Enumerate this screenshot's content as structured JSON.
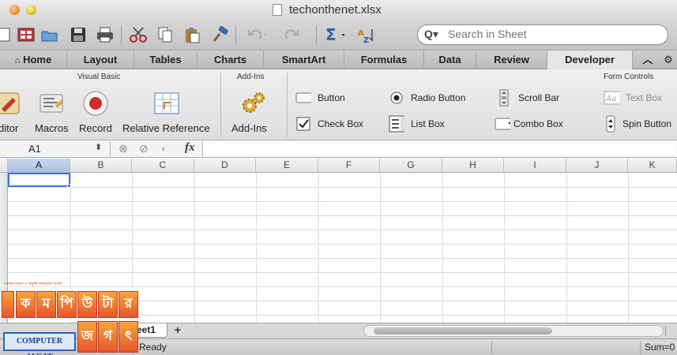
{
  "window": {
    "title": "techonthenet.xlsx"
  },
  "toolbar": {
    "buttons": [
      "new-document",
      "gallery",
      "open",
      "save",
      "print",
      "cut",
      "copy",
      "paste",
      "format-painter",
      "undo",
      "redo",
      "autosum",
      "sort-filter"
    ],
    "search_placeholder": "Search in Sheet"
  },
  "ribbon_tabs": [
    "Home",
    "Layout",
    "Tables",
    "Charts",
    "SmartArt",
    "Formulas",
    "Data",
    "Review",
    "Developer"
  ],
  "active_tab": "Developer",
  "ribbon": {
    "groups": {
      "visual_basic": "Visual Basic",
      "add_ins": "Add-Ins",
      "form_controls": "Form Controls"
    },
    "big_buttons": {
      "editor": "ditor",
      "macros": "Macros",
      "record": "Record",
      "relative_reference": "Relative Reference",
      "add_ins": "Add-Ins"
    },
    "form_controls": {
      "button": "Button",
      "radio_button": "Radio Button",
      "scroll_bar": "Scroll Bar",
      "text_box": "Text Box",
      "check_box": "Check Box",
      "list_box": "List Box",
      "combo_box": "Combo Box",
      "spin_button": "Spin Button"
    }
  },
  "formula_bar": {
    "name_box": "A1",
    "fx_label": "fx",
    "formula": ""
  },
  "grid": {
    "columns": [
      "A",
      "B",
      "C",
      "D",
      "E",
      "F",
      "G",
      "H",
      "I",
      "J",
      "K"
    ],
    "selected_column": "A",
    "selected_cell": "A1"
  },
  "sheet_tabs": {
    "active": "eet1",
    "add_label": "+"
  },
  "status": {
    "mode": "Ready",
    "sum_label": "Sum=0"
  },
  "watermark": {
    "tagline": "নানান বাংলা ও প্রযুক্তি তথ্যকেন্দ্র বাংলা",
    "glyphs": [
      "ক",
      "ম",
      "পি",
      "উ",
      "টা",
      "র"
    ],
    "lower_glyphs": [
      "জ",
      "গ",
      "ৎ"
    ],
    "brand": "COMPUTER JAGAT"
  },
  "colors": {
    "selection": "#3b78d8",
    "active_tab": "#e6e6e6"
  }
}
